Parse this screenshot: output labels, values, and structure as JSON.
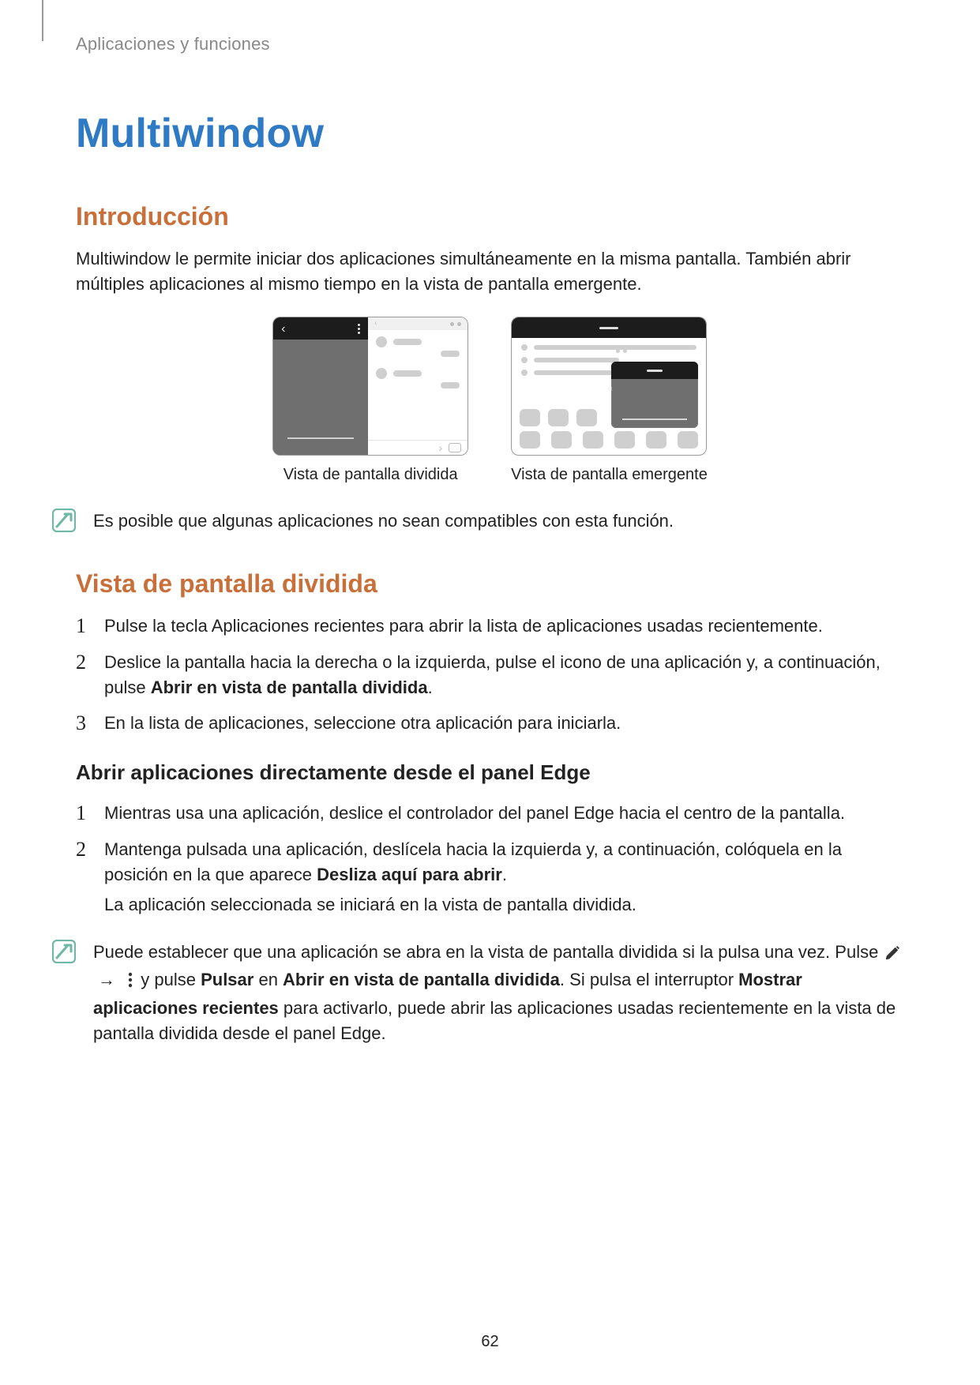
{
  "runningHead": "Aplicaciones y funciones",
  "title": "Multiwindow",
  "intro": {
    "heading": "Introducción",
    "body": "Multiwindow le permite iniciar dos aplicaciones simultáneamente en la misma pantalla. También abrir múltiples aplicaciones al mismo tiempo en la vista de pantalla emergente."
  },
  "figures": {
    "splitCaption": "Vista de pantalla dividida",
    "popupCaption": "Vista de pantalla emergente"
  },
  "note1": "Es posible que algunas aplicaciones no sean compatibles con esta función.",
  "split": {
    "heading": "Vista de pantalla dividida",
    "step1": "Pulse la tecla Aplicaciones recientes para abrir la lista de aplicaciones usadas recientemente.",
    "step2a": "Deslice la pantalla hacia la derecha o la izquierda, pulse el icono de una aplicación y, a continuación, pulse ",
    "step2bold": "Abrir en vista de pantalla dividida",
    "step2b": ".",
    "step3": "En la lista de aplicaciones, seleccione otra aplicación para iniciarla."
  },
  "edge": {
    "heading": "Abrir aplicaciones directamente desde el panel Edge",
    "step1": "Mientras usa una aplicación, deslice el controlador del panel Edge hacia el centro de la pantalla.",
    "step2a": "Mantenga pulsada una aplicación, deslícela hacia la izquierda y, a continuación, colóquela en la posición en la que aparece ",
    "step2bold": "Desliza aquí para abrir",
    "step2b": ".",
    "step2line2": "La aplicación seleccionada se iniciará en la vista de pantalla dividida."
  },
  "note2": {
    "line1": "Puede establecer que una aplicación se abra en la vista de pantalla dividida si la pulsa una vez. ",
    "pulse": "Pulse ",
    "yPulse": " y pulse ",
    "pulsar": "Pulsar",
    "en": " en ",
    "openSplit": "Abrir en vista de pantalla dividida",
    "afterOpen": ". Si pulsa el interruptor ",
    "mostrar": "Mostrar aplicaciones recientes",
    "tail": " para activarlo, puede abrir las aplicaciones usadas recientemente en la vista de pantalla dividida desde el panel Edge."
  },
  "nums": {
    "n1": "1",
    "n2": "2",
    "n3": "3"
  },
  "arrow": "→",
  "pageNumber": "62"
}
